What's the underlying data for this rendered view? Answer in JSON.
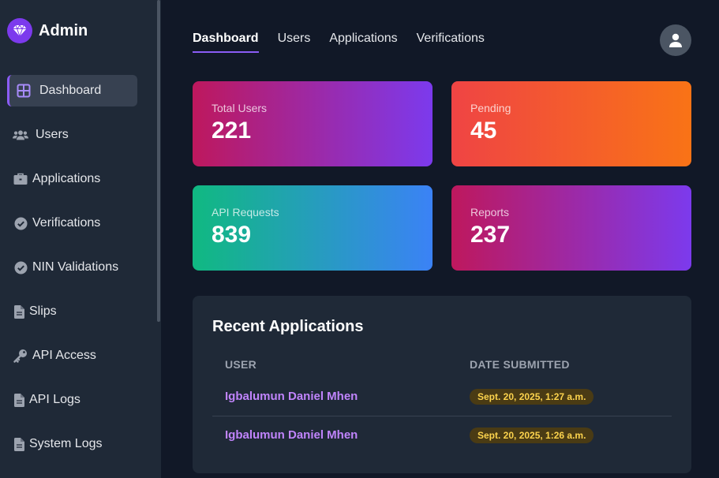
{
  "brand": {
    "name": "Admin",
    "icon": "gem-icon",
    "accent": "#7c3aed"
  },
  "sidebar": {
    "items": [
      {
        "label": "Dashboard",
        "icon": "dashboard-grid-icon",
        "active": true
      },
      {
        "label": "Users",
        "icon": "users-icon"
      },
      {
        "label": "Applications",
        "icon": "briefcase-icon"
      },
      {
        "label": "Verifications",
        "icon": "check-circle-icon"
      },
      {
        "label": "NIN Validations",
        "icon": "check-circle-icon"
      },
      {
        "label": "Slips",
        "icon": "file-icon"
      },
      {
        "label": "API Access",
        "icon": "key-icon"
      },
      {
        "label": "API Logs",
        "icon": "file-icon"
      },
      {
        "label": "System Logs",
        "icon": "file-icon"
      }
    ]
  },
  "topnav": {
    "tabs": [
      {
        "label": "Dashboard",
        "active": true
      },
      {
        "label": "Users"
      },
      {
        "label": "Applications"
      },
      {
        "label": "Verifications"
      }
    ],
    "avatar_icon": "user-icon"
  },
  "stats": [
    {
      "label": "Total Users",
      "value": "221"
    },
    {
      "label": "Pending",
      "value": "45"
    },
    {
      "label": "API Requests",
      "value": "839"
    },
    {
      "label": "Reports",
      "value": "237"
    }
  ],
  "recent": {
    "title": "Recent Applications",
    "columns": [
      "USER",
      "DATE SUBMITTED"
    ],
    "rows": [
      {
        "user": "Igbalumun Daniel Mhen",
        "date": "Sept. 20, 2025, 1:27 a.m."
      },
      {
        "user": "Igbalumun Daniel Mhen",
        "date": "Sept. 20, 2025, 1:26 a.m."
      }
    ]
  }
}
